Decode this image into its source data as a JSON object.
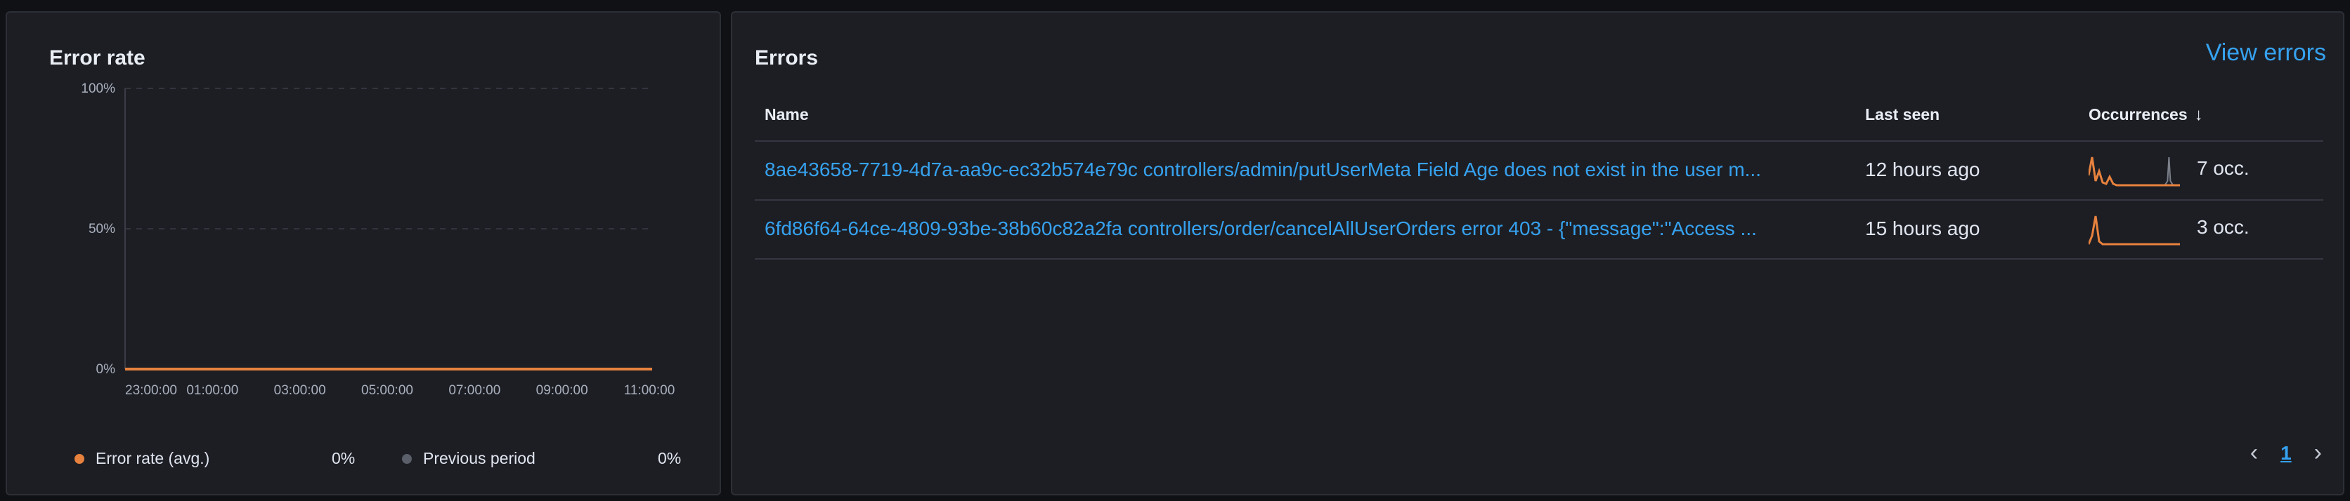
{
  "error_rate_panel": {
    "title": "Error rate",
    "legend": [
      {
        "label": "Error rate (avg.)",
        "value": "0%",
        "color": "#e7823e"
      },
      {
        "label": "Previous period",
        "value": "0%",
        "color": "#5b5f69"
      }
    ]
  },
  "chart_data": {
    "type": "line",
    "title": "",
    "xlabel": "",
    "ylabel": "",
    "y_ticks": [
      "0%",
      "50%",
      "100%"
    ],
    "ylim": [
      0,
      100
    ],
    "x": [
      "23:00:00",
      "01:00:00",
      "03:00:00",
      "05:00:00",
      "07:00:00",
      "09:00:00",
      "11:00:00"
    ],
    "series": [
      {
        "name": "Error rate (avg.)",
        "color": "#e7823e",
        "values": [
          0,
          0,
          0,
          0,
          0,
          0,
          0
        ]
      }
    ],
    "grid": true
  },
  "errors_panel": {
    "title": "Errors",
    "view_link": "View errors",
    "columns": {
      "name": "Name",
      "last_seen": "Last seen",
      "occurrences": "Occurrences"
    },
    "rows": [
      {
        "name": "8ae43658-7719-4d7a-aa9c-ec32b574e79c controllers/admin/putUserMeta Field Age does not exist in the user m...",
        "last_seen": "12 hours ago",
        "occurrences": "7 occ.",
        "spark": [
          0.35,
          1.0,
          0.15,
          0.5,
          0.1,
          0.05,
          0.3,
          0.05,
          0,
          0,
          0,
          0,
          0,
          0,
          0,
          0,
          0,
          0,
          0,
          0,
          0,
          0,
          0,
          0,
          0,
          0,
          0
        ],
        "spark_prev_peak_at": 0.88
      },
      {
        "name": "6fd86f64-64ce-4809-93be-38b60c82a2fa controllers/order/cancelAllUserOrders error 403 - {\"message\":\"Access ...",
        "last_seen": "15 hours ago",
        "occurrences": "3 occ.",
        "spark": [
          0,
          0.3,
          1.0,
          0.1,
          0,
          0,
          0,
          0,
          0,
          0,
          0,
          0,
          0,
          0,
          0,
          0,
          0,
          0,
          0,
          0,
          0,
          0,
          0,
          0,
          0,
          0,
          0
        ],
        "spark_prev_peak_at": null
      }
    ],
    "pagination": {
      "current": "1"
    }
  },
  "colors": {
    "accent": "#36a2ef",
    "series": "#e7823e",
    "previous": "#5b5f69",
    "panel_bg": "#1d1e24"
  }
}
